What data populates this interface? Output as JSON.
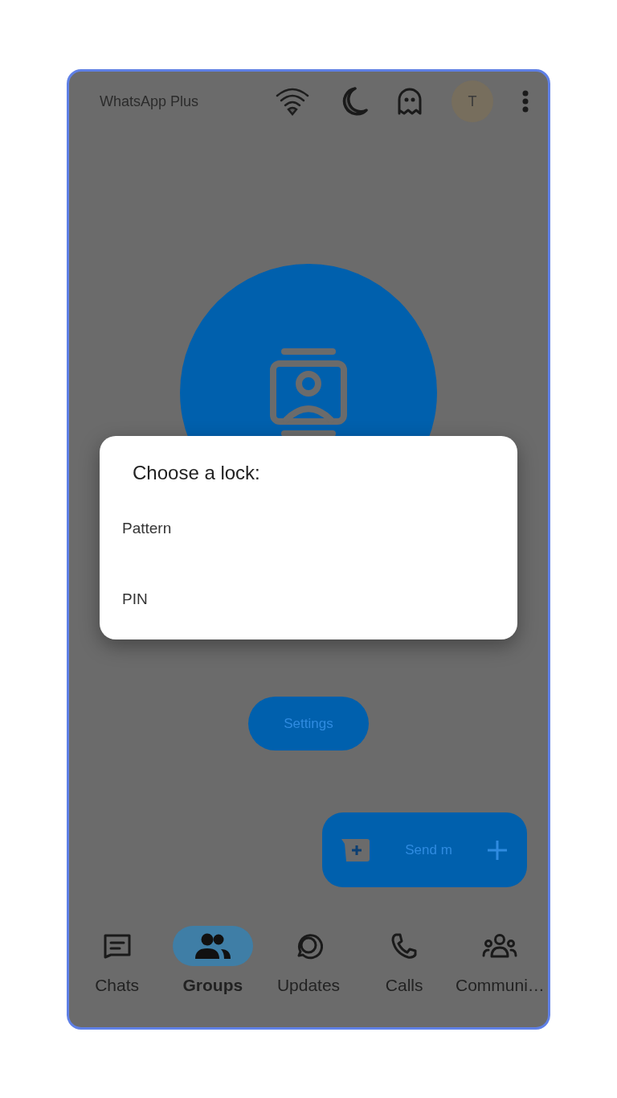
{
  "app_bar": {
    "title": "WhatsApp Plus",
    "avatar": "T"
  },
  "dialog": {
    "title": "Choose a lock:",
    "options": [
      "Pattern",
      "PIN"
    ]
  },
  "settings_button": {
    "label": "Settings"
  },
  "fab": {
    "label": "Send m"
  },
  "nav": [
    {
      "kind": "chats",
      "label": "Chats",
      "selected": false
    },
    {
      "kind": "groups",
      "label": "Groups",
      "selected": true
    },
    {
      "kind": "updates",
      "label": "Updates",
      "selected": false
    },
    {
      "kind": "calls",
      "label": "Calls",
      "selected": false
    },
    {
      "kind": "communities",
      "label": "Communi…",
      "selected": false
    }
  ]
}
